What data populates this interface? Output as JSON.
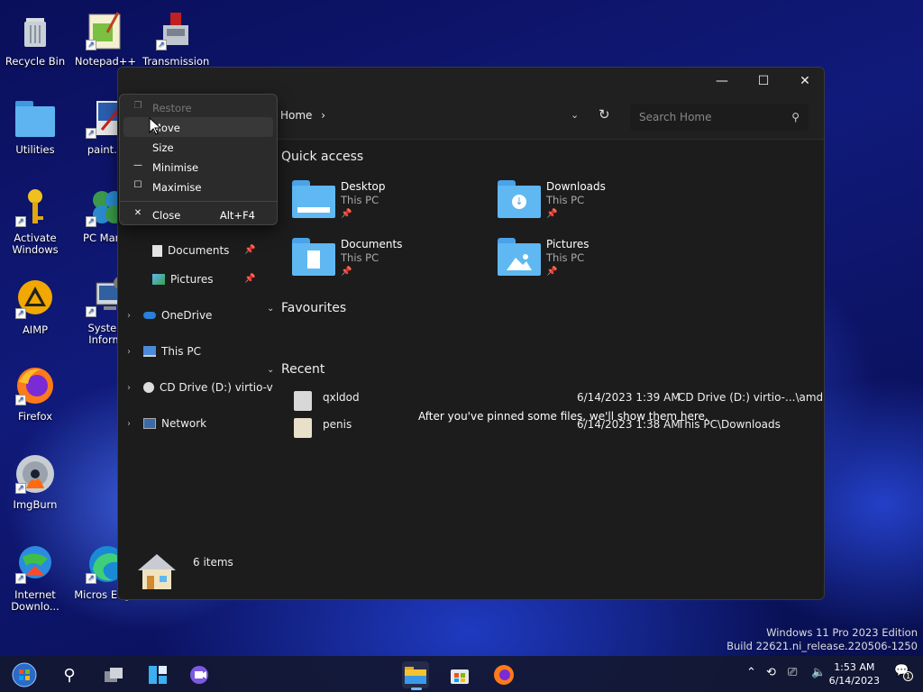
{
  "desktop": {
    "icons": [
      {
        "label": "Recycle Bin"
      },
      {
        "label": "Notepad++"
      },
      {
        "label": "Transmission"
      },
      {
        "label": "Utilities"
      },
      {
        "label": "paint.n"
      },
      {
        "label": "Activate Windows"
      },
      {
        "label": "PC Mana"
      },
      {
        "label": "AIMP"
      },
      {
        "label": "Systen Inform"
      },
      {
        "label": "Firefox"
      },
      {
        "label": "ImgBurn"
      },
      {
        "label": "Internet Downlo..."
      },
      {
        "label": "Micros Edge"
      }
    ]
  },
  "explorer": {
    "breadcrumb": "Home",
    "search_placeholder": "Search Home",
    "sidebar": {
      "pinned": [
        {
          "label": "Documents"
        },
        {
          "label": "Pictures"
        }
      ],
      "tree": [
        {
          "label": "OneDrive"
        },
        {
          "label": "This PC"
        },
        {
          "label": "CD Drive (D:) virtio-v"
        },
        {
          "label": "Network"
        }
      ]
    },
    "sections": {
      "quick_access": "Quick access",
      "favourites": "Favourites",
      "recent": "Recent"
    },
    "quick_access": [
      {
        "name": "Desktop",
        "location": "This PC"
      },
      {
        "name": "Downloads",
        "location": "This PC"
      },
      {
        "name": "Documents",
        "location": "This PC"
      },
      {
        "name": "Pictures",
        "location": "This PC"
      }
    ],
    "favourites_empty": "After you've pinned some files, we'll show them here.",
    "recent": [
      {
        "name": "qxldod",
        "date": "6/14/2023 1:39 AM",
        "location": "CD Drive (D:) virtio-...\\amd64"
      },
      {
        "name": "penis",
        "date": "6/14/2023 1:38 AM",
        "location": "This PC\\Downloads"
      }
    ],
    "status": "6 items"
  },
  "context_menu": {
    "items": [
      {
        "label": "Restore",
        "disabled": true
      },
      {
        "label": "Move"
      },
      {
        "label": "Size"
      },
      {
        "label": "Minimise"
      },
      {
        "label": "Maximise"
      },
      {
        "label": "Close",
        "shortcut": "Alt+F4"
      }
    ]
  },
  "watermark": {
    "line1": "Windows 11 Pro 2023 Edition",
    "line2": "Build 22621.ni_release.220506-1250"
  },
  "clock": {
    "time": "1:53 AM",
    "date": "6/14/2023"
  },
  "notification_count": "1",
  "colors": {
    "accent": "#5fb8f2",
    "window_bg": "#1c1c1c",
    "menu_bg": "#2b2b2b"
  }
}
